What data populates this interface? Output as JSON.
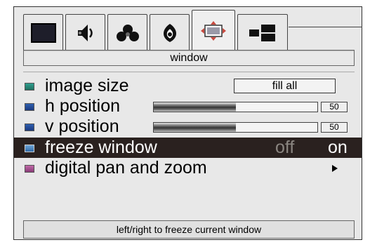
{
  "tabs": [
    {
      "icon": "picture-icon",
      "active": false
    },
    {
      "icon": "audio-icon",
      "active": false
    },
    {
      "icon": "color-icon",
      "active": false
    },
    {
      "icon": "brightness-icon",
      "active": false
    },
    {
      "icon": "window-icon",
      "active": true
    },
    {
      "icon": "setup-icon",
      "active": false
    }
  ],
  "title": "window",
  "items": {
    "image_size": {
      "label": "image size",
      "value": "fill all"
    },
    "h_position": {
      "label": "h position",
      "value": "50",
      "level": 0.5
    },
    "v_position": {
      "label": "v position",
      "value": "50",
      "level": 0.5
    },
    "freeze_window": {
      "label": "freeze window",
      "off": "off",
      "on": "on"
    },
    "digital_pan": {
      "label": "digital pan and zoom"
    }
  },
  "hint": "left/right to freeze current window",
  "colors": {
    "highlight": "#2a211f",
    "background": "#e8e8e8"
  }
}
